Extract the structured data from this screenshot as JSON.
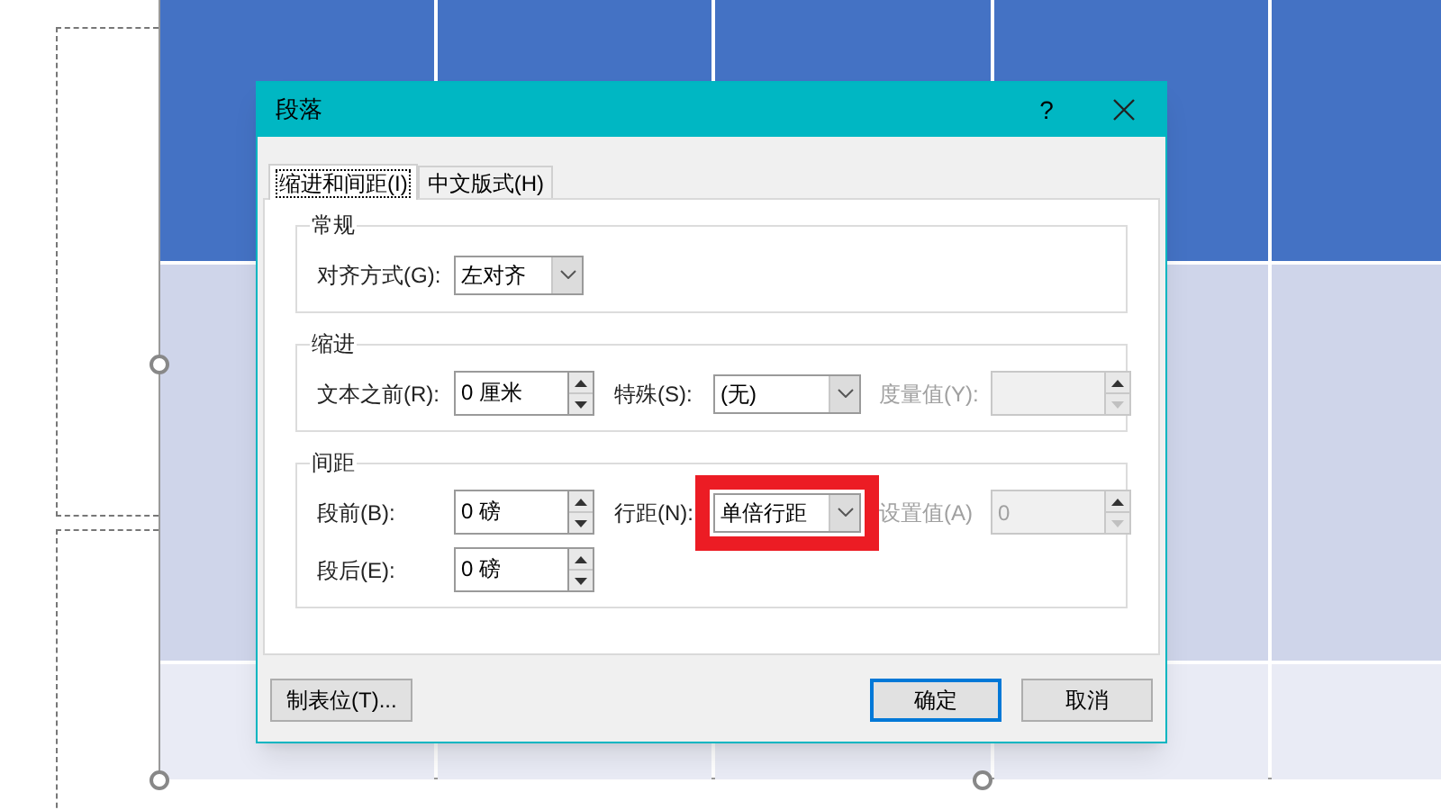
{
  "dialog": {
    "title": "段落",
    "help": "?"
  },
  "tabs": [
    {
      "label": "缩进和间距(I)",
      "selected": true
    },
    {
      "label": "中文版式(H)",
      "selected": false
    }
  ],
  "sections": [
    {
      "title": "常规",
      "rows": [
        [
          {
            "kind": "dropdown",
            "label": "对齐方式(G):",
            "value": "左对齐",
            "disabled": false,
            "highlighted": false
          }
        ]
      ]
    },
    {
      "title": "缩进",
      "rows": [
        [
          {
            "kind": "spinner",
            "label": "文本之前(R):",
            "value": "0 厘米",
            "disabled": false
          },
          {
            "kind": "dropdown",
            "label": "特殊(S):",
            "value": "(无)",
            "disabled": false,
            "highlighted": false
          },
          {
            "kind": "spinner",
            "label": "度量值(Y):",
            "disabled": true
          }
        ]
      ]
    },
    {
      "title": "间距",
      "rows": [
        [
          {
            "kind": "spinner",
            "label": "段前(B):",
            "value": "0 磅",
            "disabled": false
          },
          {
            "kind": "dropdown",
            "label": "行距(N):",
            "value": "单倍行距",
            "disabled": false,
            "highlighted": true
          },
          {
            "kind": "spinner",
            "label": "设置值(A)",
            "value": "0",
            "disabled": true
          }
        ],
        [
          {
            "kind": "spinner",
            "label": "段后(E):",
            "value": "0 磅",
            "disabled": false
          }
        ]
      ]
    }
  ],
  "buttons": [
    {
      "label": "制表位(T)...",
      "default": false
    },
    {
      "label": "确定",
      "default": true
    },
    {
      "label": "取消",
      "default": false
    }
  ]
}
